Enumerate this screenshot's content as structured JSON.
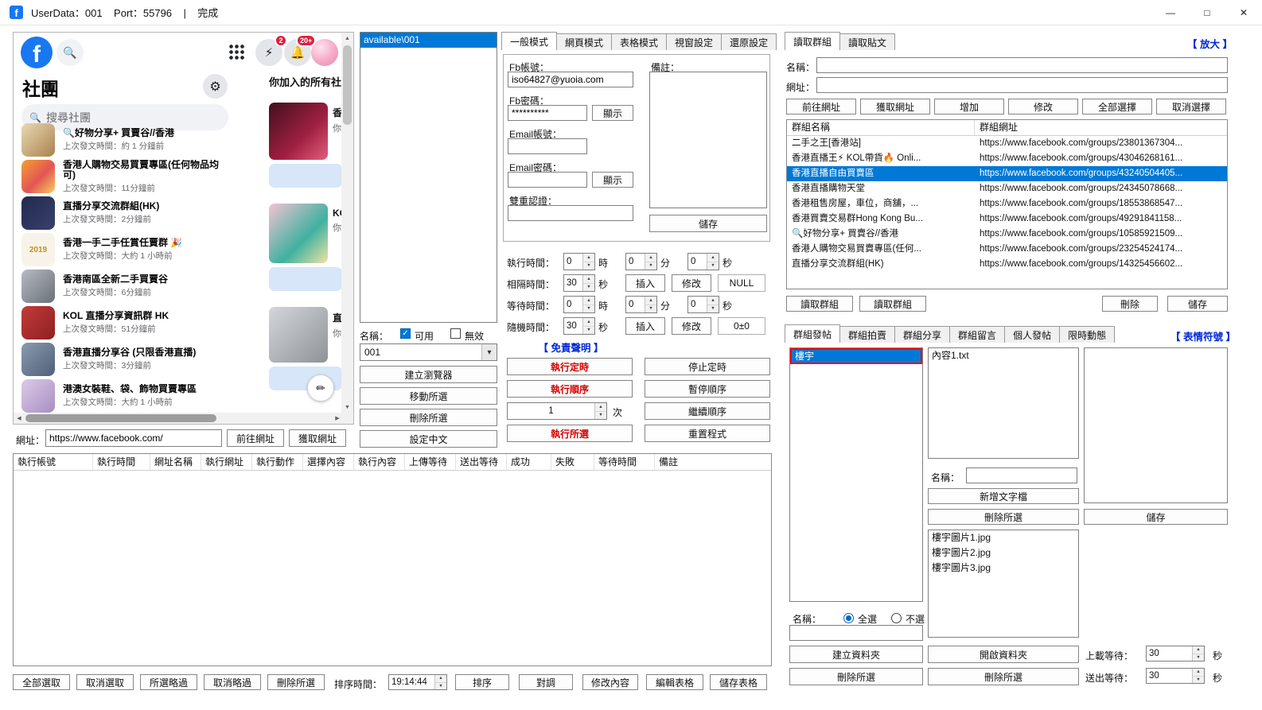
{
  "colors": {
    "facebook_blue": "#1877f2",
    "selection_blue": "#0078d7",
    "badge_red": "#e41e3f",
    "link_blue": "#0028d8",
    "danger_red": "#d50000",
    "highlight_border_red": "#ff0000"
  },
  "icons": {
    "facebook_f": "f",
    "search": "🔍",
    "gear": "⚙",
    "messenger": "⚡",
    "bell": "🔔",
    "pencil": "✏",
    "check": "✓",
    "up": "▲",
    "down": "▼",
    "left": "◀",
    "right": "▶",
    "combo": "▾",
    "minimize": "—",
    "maximize": "□",
    "close": "✕"
  },
  "titlebar": {
    "title": "UserData：001    Port：55796    |    完成"
  },
  "facebook": {
    "groups_heading": "社團",
    "search_placeholder": "搜尋社團",
    "joined_heading": "你加入的所有社團",
    "messenger_badge": "2",
    "notification_badge": "20+",
    "groups": [
      {
        "name": "🔍好物分享+ 買賣谷//香港",
        "time": "上次發文時間：約 1 分鐘前"
      },
      {
        "name": "香港人購物交易買賣專區(任何物品均可)",
        "time": "上次發文時間：11分鐘前"
      },
      {
        "name": "直播分享交流群組(HK)",
        "time": "上次發文時間：2分鐘前"
      },
      {
        "name": "香港一手二手任賞任賣群 🎉",
        "time": "上次發文時間：大約 1 小時前",
        "thumb_text": "2019"
      },
      {
        "name": "香港南區全新二手買賣谷",
        "time": "上次發文時間：6分鐘前"
      },
      {
        "name": "KOL 直播分享資訊群 HK",
        "time": "上次發文時間：51分鐘前"
      },
      {
        "name": "香港直播分享谷 (只限香港直播)",
        "time": "上次發文時間：3分鐘前"
      },
      {
        "name": "港澳女裝鞋、袋、飾物買賣專區",
        "time": "上次發文時間：大約 1 小時前"
      }
    ],
    "cards": [
      {
        "title": "香港",
        "subtitle": "你上"
      },
      {
        "title": "KOL",
        "subtitle": "你上"
      },
      {
        "title": "直播",
        "subtitle": "你上"
      }
    ]
  },
  "url_bar": {
    "label": "網址：",
    "value": "https://www.facebook.com/",
    "go": "前往網址",
    "fetch": "獲取網址"
  },
  "profiles": {
    "items": [
      "available\\001"
    ],
    "name_label": "名稱：",
    "available": "可用",
    "invalid": "無效",
    "combo_value": "001",
    "create_browser": "建立瀏覽器",
    "move_selected": "移動所選",
    "delete_selected": "刪除所選",
    "set_chinese": "設定中文"
  },
  "settings": {
    "tabs": [
      "一般模式",
      "網頁模式",
      "表格模式",
      "視窗設定",
      "還原設定"
    ],
    "fb_account_label": "Fb帳號：",
    "fb_account": "iso64827@yuoia.com",
    "fb_password_label": "Fb密碼：",
    "fb_password": "**********",
    "show": "顯示",
    "email_account_label": "Email帳號：",
    "email_password_label": "Email密碼：",
    "two_factor_label": "雙重認證：",
    "note_label": "備註：",
    "save": "儲存",
    "exec_time_label": "執行時間：",
    "interval_label": "相隔時間：",
    "wait_label": "等待時間：",
    "random_label": "隨機時間：",
    "hour": "時",
    "minute": "分",
    "second": "秒",
    "insert": "插入",
    "modify": "修改",
    "null_value": "NULL",
    "random_value": "0±0",
    "exec_h": "0",
    "exec_m": "0",
    "exec_s": "0",
    "interval_s": "30",
    "wait_h": "0",
    "wait_m": "0",
    "wait_s": "0",
    "random_s": "30",
    "disclaimer": "【 免責聲明 】",
    "run_timer": "執行定時",
    "stop_timer": "停止定時",
    "run_sequence": "執行順序",
    "pause_sequence": "暫停順序",
    "run_count": "1",
    "count_unit": "次",
    "resume_sequence": "繼續順序",
    "run_selected": "執行所選",
    "reset_program": "重置程式"
  },
  "groups_panel": {
    "tabs": [
      "讀取群組",
      "讀取貼文"
    ],
    "zoom": "【 放大 】",
    "name_label": "名稱：",
    "url_label": "網址：",
    "go": "前往網址",
    "fetch": "獲取網址",
    "add": "增加",
    "modify": "修改",
    "select_all": "全部選擇",
    "deselect_all": "取消選擇",
    "col_name": "群組名稱",
    "col_url": "群組網址",
    "rows": [
      {
        "name": "二手之王[香港站]",
        "url": "https://www.facebook.com/groups/23801367304..."
      },
      {
        "name": "香港直播王⚡ KOL帶貨🔥 Onli...",
        "url": "https://www.facebook.com/groups/43046268161..."
      },
      {
        "name": "香港直播自由買賣區",
        "url": "https://www.facebook.com/groups/43240504405..."
      },
      {
        "name": "香港直播購物天堂",
        "url": "https://www.facebook.com/groups/24345078668..."
      },
      {
        "name": "香港租售房屋，車位，商舖，...",
        "url": "https://www.facebook.com/groups/18553868547..."
      },
      {
        "name": "香港買賣交易群Hong Kong Bu...",
        "url": "https://www.facebook.com/groups/49291841158..."
      },
      {
        "name": "🔍好物分享+ 買賣谷//香港",
        "url": "https://www.facebook.com/groups/10585921509..."
      },
      {
        "name": "香港人購物交易買賣專區(任何...",
        "url": "https://www.facebook.com/groups/23254524174..."
      },
      {
        "name": "直播分享交流群組(HK)",
        "url": "https://www.facebook.com/groups/14325456602..."
      }
    ],
    "read_group_a": "讀取群組",
    "read_group_b": "讀取群組",
    "delete": "刪除",
    "save": "儲存"
  },
  "post_panel": {
    "tabs": [
      "群組發帖",
      "群組拍賣",
      "群組分享",
      "群組留言",
      "個人發帖",
      "限時動態"
    ],
    "emoji": "【 表情符號 】",
    "folders": [
      "樓宇"
    ],
    "files": [
      "內容1.txt"
    ],
    "images": [
      "樓宇圖片1.jpg",
      "樓宇圖片2.jpg",
      "樓宇圖片3.jpg"
    ],
    "name_label": "名稱：",
    "select_all": "全選",
    "select_none": "不選",
    "new_text_file": "新增文字檔",
    "delete_selected_a": "刪除所選",
    "delete_selected_b": "刪除所選",
    "delete_selected_c": "刪除所選",
    "save": "儲存",
    "create_folder": "建立資料夾",
    "open_folder": "開啟資料夾",
    "upload_wait_label": "上載等待：",
    "upload_wait": "30",
    "send_wait_label": "送出等待：",
    "send_wait": "30",
    "seconds": "秒"
  },
  "task_table": {
    "headers": [
      "執行帳號",
      "執行時間",
      "網址名稱",
      "執行網址",
      "執行動作",
      "選擇內容",
      "執行內容",
      "上傳等待",
      "送出等待",
      "成功",
      "失敗",
      "等待時間",
      "備註"
    ]
  },
  "bottom_bar": {
    "select_all": "全部選取",
    "deselect_all": "取消選取",
    "skip_selected": "所選略過",
    "unskip_selected": "取消略過",
    "delete_selected": "刪除所選",
    "sort_time_label": "排序時間：",
    "sort_time": "19:14:44",
    "sort": "排序",
    "swap": "對調",
    "modify_content": "修改內容",
    "edit_table": "編輯表格",
    "save_table": "儲存表格"
  }
}
